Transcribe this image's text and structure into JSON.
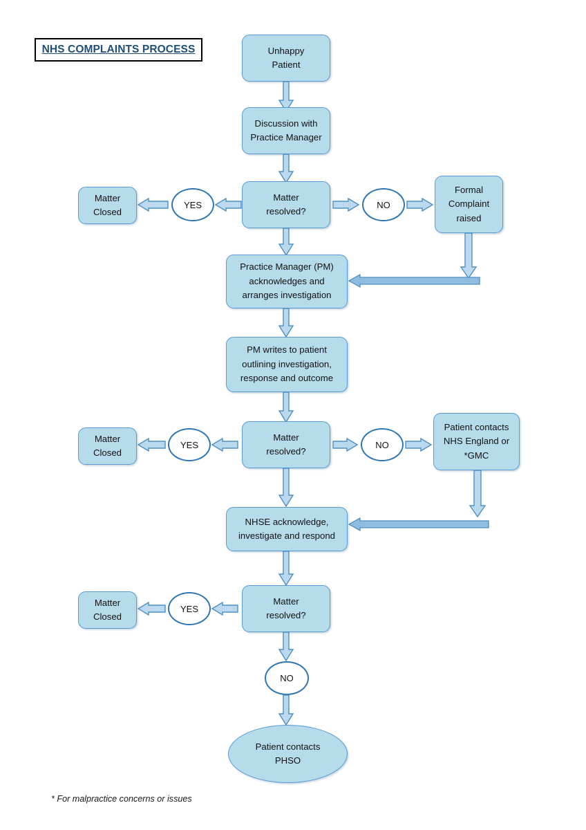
{
  "page": {
    "title": "NHS COMPLAINTS PROCESS",
    "footnote": "* For malpractice concerns or issues",
    "background": "#FFFFFF"
  },
  "colors": {
    "node_fill": "#B6DCEB",
    "node_border": "#5B9BD5",
    "decision_border": "#2E75B6",
    "decision_fill": "#FFFFFF",
    "arrow_fill": "#BBD9EE",
    "arrow_border": "#4E8FC0",
    "title_text": "#1F4E79",
    "title_border": "#000000"
  },
  "chart_data": {
    "type": "diagram",
    "diagram_kind": "flowchart",
    "title": "NHS COMPLAINTS PROCESS",
    "nodes": [
      {
        "id": "unhappy_patient",
        "shape": "rounded-rect",
        "lines": [
          "Unhappy",
          "Patient"
        ]
      },
      {
        "id": "discussion_pm",
        "shape": "rounded-rect",
        "lines": [
          "Discussion with",
          "Practice Manager"
        ]
      },
      {
        "id": "resolved_1",
        "shape": "rounded-rect",
        "lines": [
          "Matter",
          "resolved?"
        ]
      },
      {
        "id": "yes_1",
        "shape": "ellipse",
        "lines": [
          "YES"
        ]
      },
      {
        "id": "closed_1",
        "shape": "rounded-rect",
        "lines": [
          "Matter",
          "Closed"
        ]
      },
      {
        "id": "no_1",
        "shape": "ellipse",
        "lines": [
          "NO"
        ]
      },
      {
        "id": "formal_complaint",
        "shape": "rounded-rect",
        "lines": [
          "Formal",
          "Complaint",
          "raised"
        ]
      },
      {
        "id": "pm_acknowledges",
        "shape": "rounded-rect",
        "lines": [
          "Practice Manager (PM)",
          "acknowledges and",
          "arranges investigation"
        ]
      },
      {
        "id": "pm_writes",
        "shape": "rounded-rect",
        "lines": [
          "PM writes to patient",
          "outlining investigation,",
          "response and outcome"
        ]
      },
      {
        "id": "resolved_2",
        "shape": "rounded-rect",
        "lines": [
          "Matter",
          "resolved?"
        ]
      },
      {
        "id": "yes_2",
        "shape": "ellipse",
        "lines": [
          "YES"
        ]
      },
      {
        "id": "closed_2",
        "shape": "rounded-rect",
        "lines": [
          "Matter",
          "Closed"
        ]
      },
      {
        "id": "no_2",
        "shape": "ellipse",
        "lines": [
          "NO"
        ]
      },
      {
        "id": "patient_nhse_gmc",
        "shape": "rounded-rect",
        "lines": [
          "Patient contacts",
          "NHS England or",
          "*GMC"
        ]
      },
      {
        "id": "nhse_ack",
        "shape": "rounded-rect",
        "lines": [
          "NHSE acknowledge,",
          "investigate and respond"
        ]
      },
      {
        "id": "resolved_3",
        "shape": "rounded-rect",
        "lines": [
          "Matter",
          "resolved?"
        ]
      },
      {
        "id": "yes_3",
        "shape": "ellipse",
        "lines": [
          "YES"
        ]
      },
      {
        "id": "closed_3",
        "shape": "rounded-rect",
        "lines": [
          "Matter",
          "Closed"
        ]
      },
      {
        "id": "no_3",
        "shape": "ellipse",
        "lines": [
          "NO"
        ]
      },
      {
        "id": "patient_phso",
        "shape": "ellipse-filled",
        "lines": [
          "Patient contacts",
          "PHSO"
        ]
      }
    ],
    "edges": [
      {
        "from": "unhappy_patient",
        "to": "discussion_pm",
        "direction": "down"
      },
      {
        "from": "discussion_pm",
        "to": "resolved_1",
        "direction": "down"
      },
      {
        "from": "resolved_1",
        "to": "yes_1",
        "direction": "left"
      },
      {
        "from": "yes_1",
        "to": "closed_1",
        "direction": "left"
      },
      {
        "from": "resolved_1",
        "to": "no_1",
        "direction": "right"
      },
      {
        "from": "no_1",
        "to": "formal_complaint",
        "direction": "right"
      },
      {
        "from": "resolved_1",
        "to": "pm_acknowledges",
        "direction": "down"
      },
      {
        "from": "formal_complaint",
        "to": "pm_acknowledges",
        "direction": "down-then-left"
      },
      {
        "from": "pm_acknowledges",
        "to": "pm_writes",
        "direction": "down"
      },
      {
        "from": "pm_writes",
        "to": "resolved_2",
        "direction": "down"
      },
      {
        "from": "resolved_2",
        "to": "yes_2",
        "direction": "left"
      },
      {
        "from": "yes_2",
        "to": "closed_2",
        "direction": "left"
      },
      {
        "from": "resolved_2",
        "to": "no_2",
        "direction": "right"
      },
      {
        "from": "no_2",
        "to": "patient_nhse_gmc",
        "direction": "right"
      },
      {
        "from": "resolved_2",
        "to": "nhse_ack",
        "direction": "down"
      },
      {
        "from": "patient_nhse_gmc",
        "to": "nhse_ack",
        "direction": "down-then-left"
      },
      {
        "from": "nhse_ack",
        "to": "resolved_3",
        "direction": "down"
      },
      {
        "from": "resolved_3",
        "to": "yes_3",
        "direction": "left"
      },
      {
        "from": "yes_3",
        "to": "closed_3",
        "direction": "left"
      },
      {
        "from": "resolved_3",
        "to": "no_3",
        "direction": "down"
      },
      {
        "from": "no_3",
        "to": "patient_phso",
        "direction": "down"
      }
    ]
  },
  "nodes": {
    "unhappy_patient": {
      "l1": "Unhappy",
      "l2": "Patient",
      "l3": ""
    },
    "discussion_pm": {
      "l1": "Discussion with",
      "l2": "Practice Manager",
      "l3": ""
    },
    "resolved_1": {
      "l1": "Matter",
      "l2": "resolved?",
      "l3": ""
    },
    "yes_1": {
      "l1": "YES"
    },
    "closed_1": {
      "l1": "Matter",
      "l2": "Closed",
      "l3": ""
    },
    "no_1": {
      "l1": "NO"
    },
    "formal_complaint": {
      "l1": "Formal",
      "l2": "Complaint",
      "l3": "raised"
    },
    "pm_acknowledges": {
      "l1": "Practice Manager (PM)",
      "l2": "acknowledges and",
      "l3": "arranges investigation"
    },
    "pm_writes": {
      "l1": "PM writes to patient",
      "l2": "outlining investigation,",
      "l3": "response and outcome"
    },
    "resolved_2": {
      "l1": "Matter",
      "l2": "resolved?",
      "l3": ""
    },
    "yes_2": {
      "l1": "YES"
    },
    "closed_2": {
      "l1": "Matter",
      "l2": "Closed",
      "l3": ""
    },
    "no_2": {
      "l1": "NO"
    },
    "patient_nhse_gmc": {
      "l1": "Patient contacts",
      "l2": "NHS England or",
      "l3": "*GMC"
    },
    "nhse_ack": {
      "l1": "NHSE acknowledge,",
      "l2": "investigate and respond",
      "l3": ""
    },
    "resolved_3": {
      "l1": "Matter",
      "l2": "resolved?",
      "l3": ""
    },
    "yes_3": {
      "l1": "YES"
    },
    "closed_3": {
      "l1": "Matter",
      "l2": "Closed",
      "l3": ""
    },
    "no_3": {
      "l1": "NO"
    },
    "patient_phso": {
      "l1": "Patient contacts",
      "l2": "PHSO",
      "l3": ""
    }
  }
}
